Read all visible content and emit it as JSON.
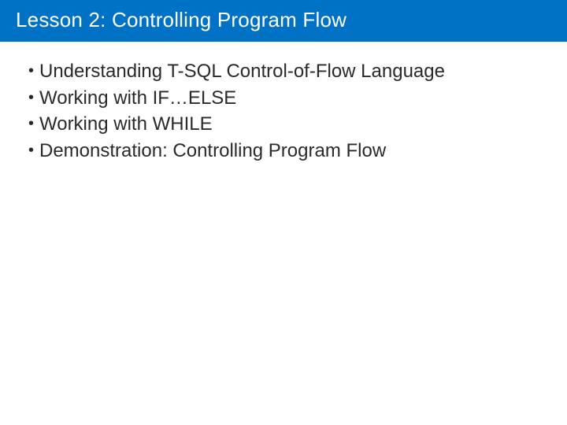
{
  "slide": {
    "title": "Lesson 2: Controlling Program Flow",
    "bullets": [
      "Understanding T-SQL Control-of-Flow Language",
      "Working with IF…ELSE",
      "Working with WHILE",
      "Demonstration: Controlling Program Flow"
    ]
  },
  "colors": {
    "title_bg": "#0072c6",
    "title_fg": "#ffffff",
    "body_fg": "#2a2a2a"
  }
}
